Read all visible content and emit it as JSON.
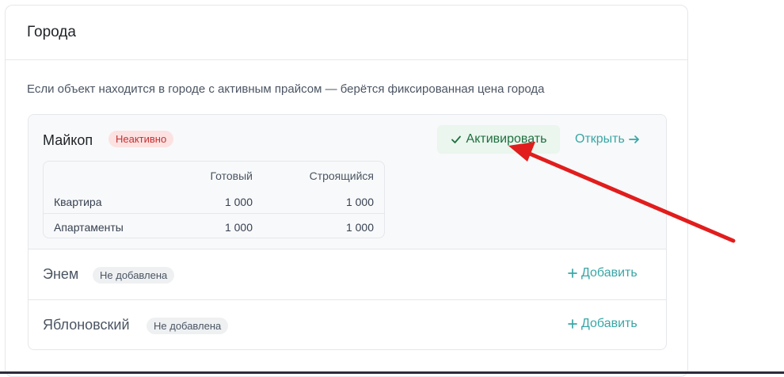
{
  "section": {
    "title": "Города",
    "description": "Если объект находится в городе с активным прайсом — берётся фиксированная цена города"
  },
  "cities": [
    {
      "name": "Майкоп",
      "status": "Неактивно",
      "activate_label": "Активировать",
      "open_label": "Открыть",
      "prices": {
        "headers": [
          "",
          "Готовый",
          "Строящийся"
        ],
        "rows": [
          {
            "type": "Квартира",
            "ready": "1 000",
            "building": "1 000"
          },
          {
            "type": "Апартаменты",
            "ready": "1 000",
            "building": "1 000"
          }
        ]
      }
    },
    {
      "name": "Энем",
      "status": "Не добавлена",
      "add_label": "Добавить"
    },
    {
      "name": "Яблоновский",
      "status": "Не добавлена",
      "add_label": "Добавить"
    }
  ],
  "colors": {
    "accent_link": "#3aa6a6",
    "activate_bg": "#eaf6ee",
    "inactive_badge_bg": "#fde2e2",
    "annotation_arrow": "#e11d1d"
  },
  "icons": {
    "activate": "check-icon",
    "open": "arrow-right-icon",
    "add": "plus-icon"
  }
}
